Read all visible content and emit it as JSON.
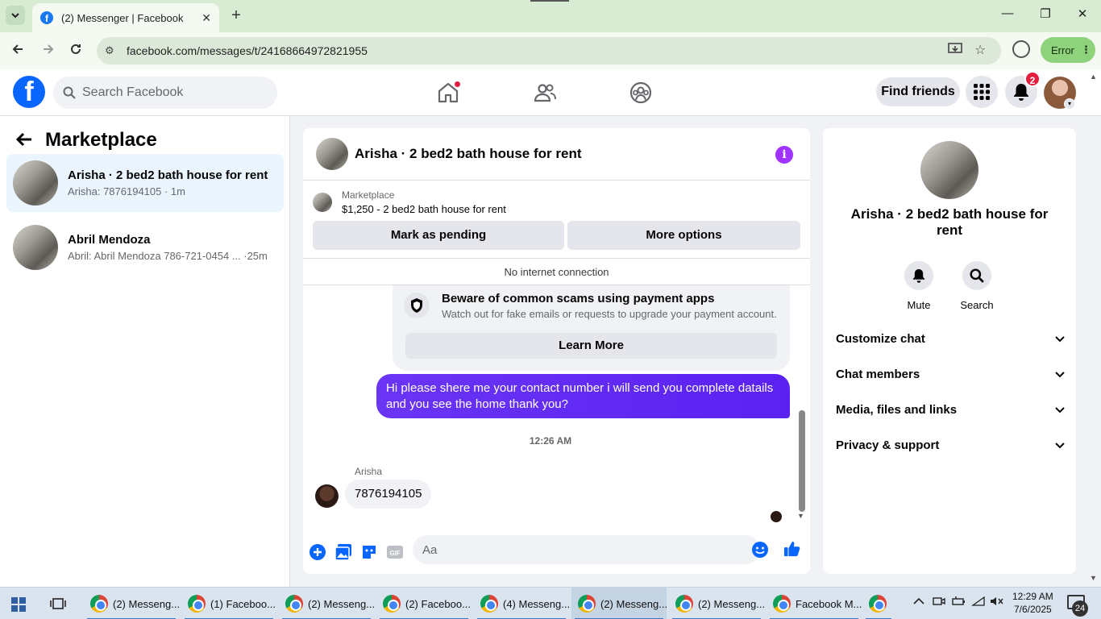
{
  "browser": {
    "tab_title": "(2) Messenger | Facebook",
    "url": "facebook.com/messages/t/24168664972821955",
    "error_label": "Error"
  },
  "header": {
    "search_placeholder": "Search Facebook",
    "find_friends": "Find friends",
    "notification_count": "2"
  },
  "sidebar": {
    "title": "Marketplace",
    "conversations": [
      {
        "name": "Arisha · 2 bed2 bath house for rent",
        "preview": "Arisha: 7876194105 · 1m"
      },
      {
        "name": "Abril Mendoza",
        "preview": "Abril: Abril Mendoza 786-721-0454 ... ·25m"
      }
    ]
  },
  "chat": {
    "title": "Arisha · 2 bed2 bath house for rent",
    "marketplace_label": "Marketplace",
    "listing": "$1,250 - 2 bed2 bath house for rent",
    "mark_pending": "Mark as pending",
    "more_options": "More options",
    "no_internet": "No internet connection",
    "scam_title": "Beware of common scams using payment apps",
    "scam_desc": "Watch out for fake emails or requests to upgrade your payment account.",
    "learn_more": "Learn More",
    "outgoing_message": "Hi please shere me your contact number i will send you complete datails and you see the home thank you?",
    "timestamp": "12:26 AM",
    "sender_name": "Arisha",
    "incoming_message": "7876194105",
    "composer_placeholder": "Aa"
  },
  "details": {
    "name": "Arisha · 2 bed2 bath house for rent",
    "mute": "Mute",
    "search": "Search",
    "sections": [
      "Customize chat",
      "Chat members",
      "Media, files and links",
      "Privacy & support"
    ]
  },
  "taskbar": {
    "items": [
      "(2) Messeng...",
      "(1) Faceboo...",
      "(2) Messeng...",
      "(2) Faceboo...",
      "(4) Messeng...",
      "(2) Messeng...",
      "(2) Messeng...",
      "Facebook M..."
    ],
    "time": "12:29 AM",
    "date": "7/6/2025",
    "notifications": "24"
  },
  "colors": {
    "fb_blue": "#0866ff",
    "messenger_purple": "#6a35f5",
    "badge_red": "#e41e3f"
  }
}
